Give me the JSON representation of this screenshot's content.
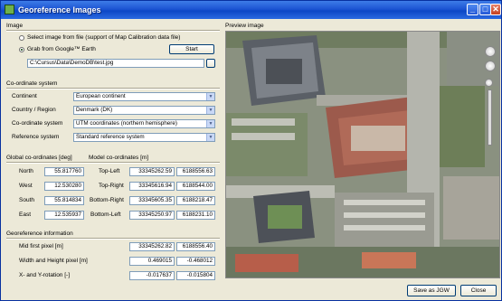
{
  "window": {
    "title": "Georeference Images"
  },
  "image_section": {
    "label": "Image",
    "option_file": "Select image from file (support of Map Calibration data file)",
    "option_google": "Grab from Google™ Earth",
    "start_label": "Start",
    "path_value": "C:\\Cursus\\Data\\DemoDB\\test.jpg"
  },
  "coord_system": {
    "label": "Co-ordinate system",
    "rows": [
      {
        "label": "Continent",
        "value": "European continent"
      },
      {
        "label": "Country / Region",
        "value": "Denmark (DK)"
      },
      {
        "label": "Co-ordinate system",
        "value": "UTM coordinates (northern hemisphere)"
      },
      {
        "label": "Reference system",
        "value": "Standard reference system"
      }
    ]
  },
  "global": {
    "label": "Global co-ordinates [deg]",
    "rows": [
      {
        "label": "North",
        "value": "55.817760"
      },
      {
        "label": "West",
        "value": "12.530280"
      },
      {
        "label": "South",
        "value": "55.814834"
      },
      {
        "label": "East",
        "value": "12.535937"
      }
    ]
  },
  "model": {
    "label": "Model co-ordinates [m]",
    "rows": [
      {
        "label": "Top-Left",
        "x": "33345262.59",
        "y": "6188556.63"
      },
      {
        "label": "Top-Right",
        "x": "33345616.94",
        "y": "6188544.00"
      },
      {
        "label": "Bottom-Right",
        "x": "33345605.35",
        "y": "6188218.47"
      },
      {
        "label": "Bottom-Left",
        "x": "33345250.97",
        "y": "6188231.10"
      }
    ]
  },
  "georef": {
    "label": "Georeference information",
    "rows": [
      {
        "label": "Mid first pixel [m]",
        "a": "33345262.82",
        "b": "6188556.40"
      },
      {
        "label": "Width and Height pixel [m]",
        "a": "0.469015",
        "b": "-0.468012"
      },
      {
        "label": "X- and Y-rotation [-]",
        "a": "-0.017637",
        "b": "-0.015804"
      }
    ]
  },
  "preview": {
    "label": "Preview image"
  },
  "footer": {
    "save_label": "Save as JGW",
    "close_label": "Close"
  }
}
